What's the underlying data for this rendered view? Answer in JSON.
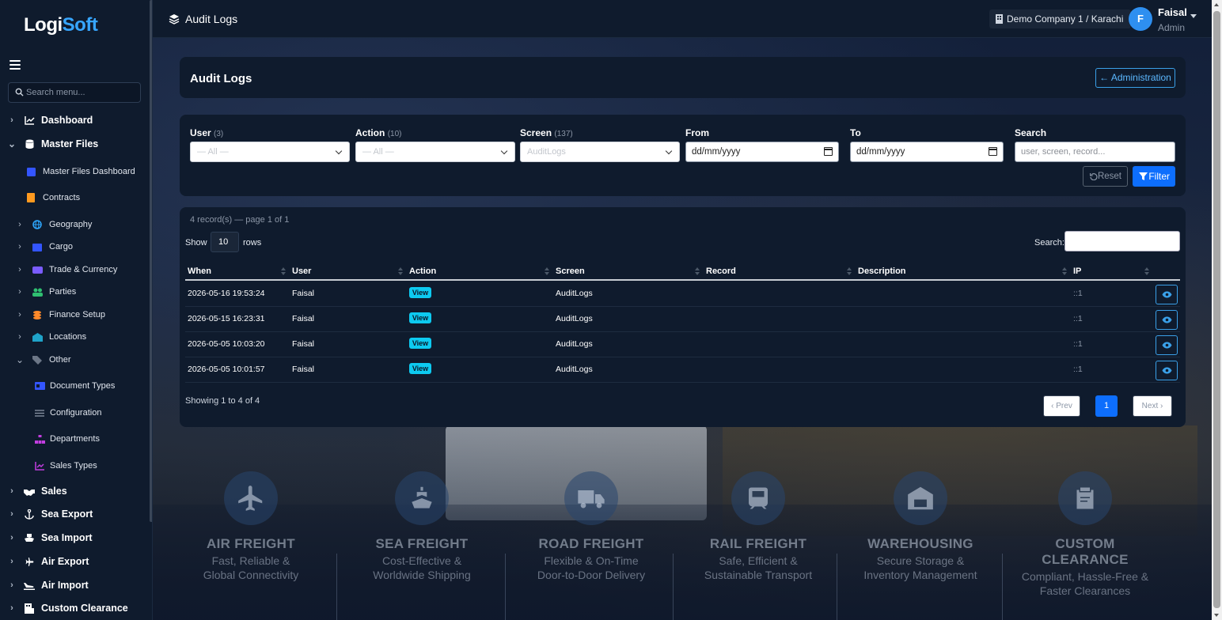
{
  "app": {
    "logo_main": "Logi",
    "logo_accent": "Soft"
  },
  "sidebar": {
    "search_placeholder": "Search menu...",
    "items": [
      {
        "label": "Dashboard",
        "icon": "chart-line-icon",
        "chevron": "›"
      },
      {
        "label": "Master Files",
        "icon": "database-icon",
        "chevron": "⌄"
      },
      {
        "label": "Master Files Dashboard",
        "icon": "square-icon"
      },
      {
        "label": "Contracts",
        "icon": "file-icon"
      },
      {
        "label": "Geography",
        "icon": "globe-icon",
        "chevron": "›"
      },
      {
        "label": "Cargo",
        "icon": "box-icon",
        "chevron": "›"
      },
      {
        "label": "Trade & Currency",
        "icon": "exchange-icon",
        "chevron": "›"
      },
      {
        "label": "Parties",
        "icon": "users-icon",
        "chevron": "›"
      },
      {
        "label": "Finance Setup",
        "icon": "coins-icon",
        "chevron": "›"
      },
      {
        "label": "Locations",
        "icon": "warehouse-icon",
        "chevron": "›"
      },
      {
        "label": "Other",
        "icon": "tags-icon",
        "chevron": "⌄"
      },
      {
        "label": "Document Types",
        "icon": "id-card-icon"
      },
      {
        "label": "Configuration",
        "icon": "sliders-icon"
      },
      {
        "label": "Departments",
        "icon": "sitemap-icon"
      },
      {
        "label": "Sales Types",
        "icon": "chart-icon"
      },
      {
        "label": "Sales",
        "icon": "handshake-icon",
        "chevron": "›"
      },
      {
        "label": "Sea Export",
        "icon": "anchor-icon",
        "chevron": "›"
      },
      {
        "label": "Sea Import",
        "icon": "ship-icon",
        "chevron": "›"
      },
      {
        "label": "Air Export",
        "icon": "plane-icon",
        "chevron": "›"
      },
      {
        "label": "Air Import",
        "icon": "plane-arrival-icon",
        "chevron": "›"
      },
      {
        "label": "Custom Clearance",
        "icon": "building-icon",
        "chevron": "›"
      }
    ]
  },
  "topbar": {
    "title": "Audit Logs",
    "company": "Demo Company 1 / Karachi",
    "user_initial": "F",
    "user_name": "Faisal",
    "user_role": "Admin"
  },
  "header": {
    "title": "Audit Logs",
    "back_button": "Administration"
  },
  "filters": {
    "user": {
      "label": "User",
      "count": "(3)",
      "value": "— All —"
    },
    "action": {
      "label": "Action",
      "count": "(10)",
      "value": "— All —"
    },
    "screen": {
      "label": "Screen",
      "count": "(137)",
      "value": "AuditLogs"
    },
    "from": {
      "label": "From",
      "value": "dd/mm/yyyy"
    },
    "to": {
      "label": "To",
      "value": "dd/mm/yyyy"
    },
    "search": {
      "label": "Search",
      "placeholder": "user, screen, record..."
    },
    "reset": "Reset",
    "filter": "Filter"
  },
  "table": {
    "record_info": "4 record(s) — page 1 of 1",
    "show_label": "Show",
    "page_size": "10",
    "rows_label": "rows",
    "search_label": "Search:",
    "columns": [
      "When",
      "User",
      "Action",
      "Screen",
      "Record",
      "Description",
      "IP"
    ],
    "rows": [
      {
        "when": "2026-05-16 19:53:24",
        "user": "Faisal",
        "action": "View",
        "screen": "AuditLogs",
        "record": "",
        "description": "",
        "ip": "::1"
      },
      {
        "when": "2026-05-15 16:23:31",
        "user": "Faisal",
        "action": "View",
        "screen": "AuditLogs",
        "record": "",
        "description": "",
        "ip": "::1"
      },
      {
        "when": "2026-05-05 10:03:20",
        "user": "Faisal",
        "action": "View",
        "screen": "AuditLogs",
        "record": "",
        "description": "",
        "ip": "::1"
      },
      {
        "when": "2026-05-05 10:01:57",
        "user": "Faisal",
        "action": "View",
        "screen": "AuditLogs",
        "record": "",
        "description": "",
        "ip": "::1"
      }
    ],
    "showing": "Showing 1 to 4 of 4",
    "prev": "‹ Prev",
    "page": "1",
    "next": "Next ›"
  },
  "services": [
    {
      "title": "AIR FREIGHT",
      "line1": "Fast, Reliable &",
      "line2": "Global Connectivity",
      "icon": "plane-icon"
    },
    {
      "title": "SEA FREIGHT",
      "line1": "Cost-Effective &",
      "line2": "Worldwide Shipping",
      "icon": "ship-icon"
    },
    {
      "title": "ROAD FREIGHT",
      "line1": "Flexible & On-Time",
      "line2": "Door-to-Door Delivery",
      "icon": "truck-icon"
    },
    {
      "title": "RAIL FREIGHT",
      "line1": "Safe, Efficient &",
      "line2": "Sustainable Transport",
      "icon": "train-icon"
    },
    {
      "title": "WAREHOUSING",
      "line1": "Secure Storage &",
      "line2": "Inventory Management",
      "icon": "warehouse-icon"
    },
    {
      "title": "CUSTOM CLEARANCE",
      "line1": "Compliant, Hassle-Free &",
      "line2": "Faster Clearances",
      "icon": "clipboard-check-icon"
    }
  ],
  "colors": {
    "accent": "#0d6efd",
    "badge": "#0dcaf0",
    "link": "#3aa0e8",
    "background": "#0b1526",
    "panel": "#0f1b2d"
  }
}
